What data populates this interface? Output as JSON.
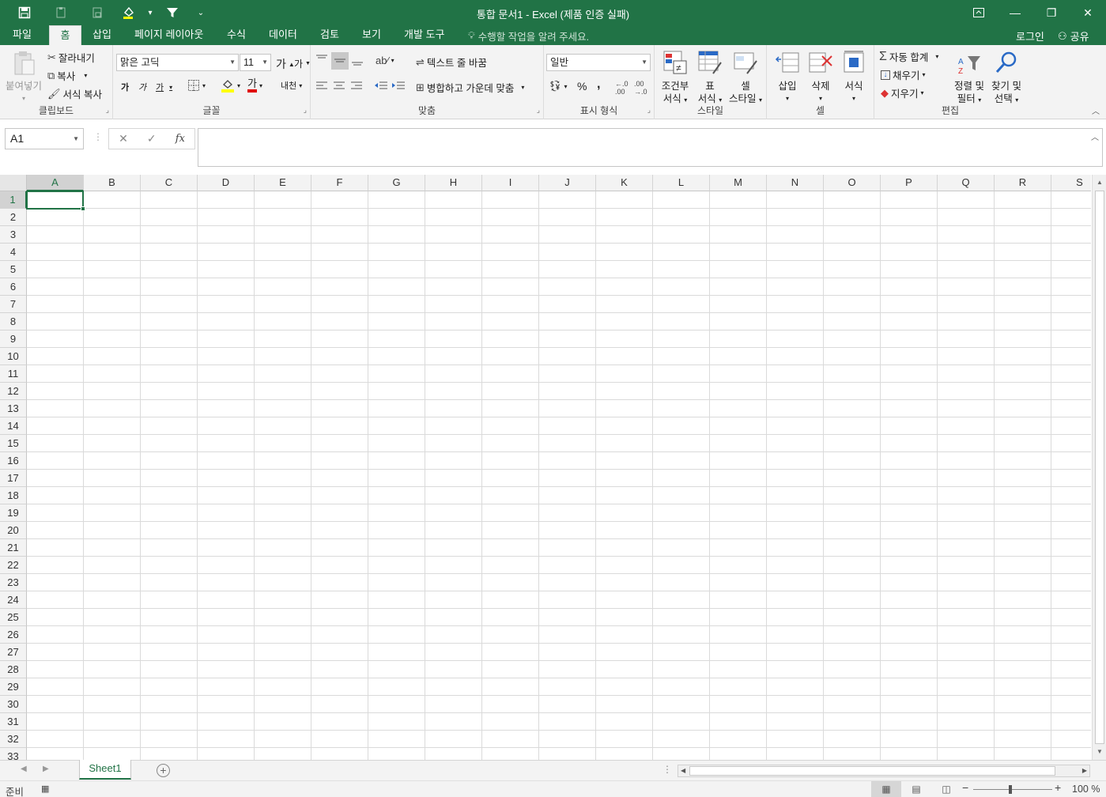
{
  "window": {
    "title": "통합 문서1 - Excel (제품 인증 실패)"
  },
  "tabs": [
    "파일",
    "홈",
    "삽입",
    "페이지 레이아웃",
    "수식",
    "데이터",
    "검토",
    "보기",
    "개발 도구"
  ],
  "active_tab": "홈",
  "tell_me": "수행할 작업을 알려 주세요.",
  "account": {
    "login": "로그인",
    "share": "공유"
  },
  "ribbon": {
    "clipboard": {
      "label": "클립보드",
      "paste": "붙여넣기",
      "cut": "잘라내기",
      "copy": "복사",
      "format_painter": "서식 복사"
    },
    "font": {
      "label": "글꼴",
      "font_name": "맑은 고딕",
      "font_size": "11",
      "grow": "가",
      "shrink": "가",
      "bold": "가",
      "italic": "가",
      "underline": "가",
      "font_color": "가",
      "phonetic": "내천"
    },
    "alignment": {
      "label": "맞춤",
      "wrap_text": "텍스트 줄 바꿈",
      "merge_center": "병합하고 가운데 맞춤"
    },
    "number": {
      "label": "표시 형식",
      "format": "일반",
      "percent": "%",
      "comma": ","
    },
    "styles": {
      "label": "스타일",
      "conditional_top": "조건부",
      "conditional_bottom": "서식",
      "table_top": "표",
      "table_bottom": "서식",
      "cell_top": "셀",
      "cell_bottom": "스타일"
    },
    "cells": {
      "label": "셀",
      "insert": "삽입",
      "delete": "삭제",
      "format": "서식"
    },
    "editing": {
      "label": "편집",
      "autosum": "자동 합계",
      "fill": "채우기",
      "clear": "지우기",
      "sort_top": "정렬 및",
      "sort_bottom": "필터",
      "find_top": "찾기 및",
      "find_bottom": "선택"
    }
  },
  "formula_bar": {
    "name_box": "A1",
    "fx": "fx",
    "value": ""
  },
  "grid": {
    "columns": [
      "A",
      "B",
      "C",
      "D",
      "E",
      "F",
      "G",
      "H",
      "I",
      "J",
      "K",
      "L",
      "M",
      "N",
      "O",
      "P",
      "Q",
      "R",
      "S"
    ],
    "rows": [
      "1",
      "2",
      "3",
      "4",
      "5",
      "6",
      "7",
      "8",
      "9",
      "10",
      "11",
      "12",
      "13",
      "14",
      "15",
      "16",
      "17",
      "18",
      "19",
      "20",
      "21",
      "22",
      "23",
      "24",
      "25",
      "26",
      "27",
      "28",
      "29",
      "30",
      "31",
      "32",
      "33"
    ],
    "active_cell": "A1"
  },
  "sheets": [
    "Sheet1"
  ],
  "status": {
    "ready": "준비",
    "zoom": "100 %"
  },
  "colors": {
    "accent": "#217346"
  }
}
